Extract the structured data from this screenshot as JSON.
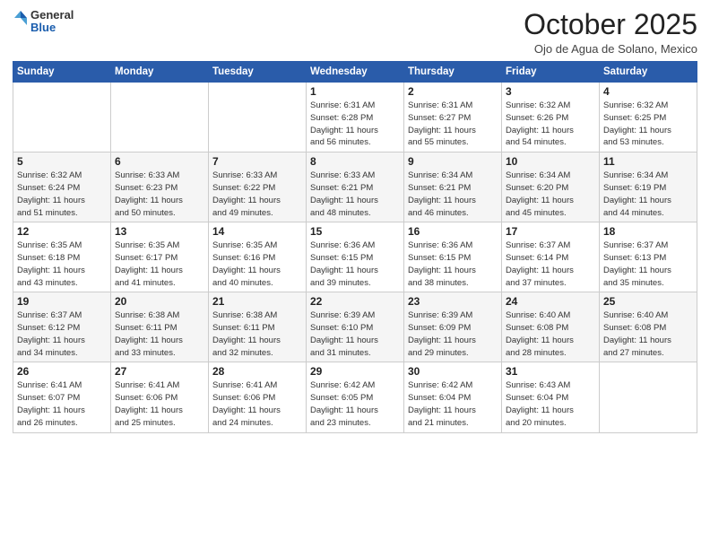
{
  "header": {
    "logo": {
      "general": "General",
      "blue": "Blue"
    },
    "title": "October 2025",
    "location": "Ojo de Agua de Solano, Mexico"
  },
  "weekdays": [
    "Sunday",
    "Monday",
    "Tuesday",
    "Wednesday",
    "Thursday",
    "Friday",
    "Saturday"
  ],
  "weeks": [
    [
      {
        "day": "",
        "info": ""
      },
      {
        "day": "",
        "info": ""
      },
      {
        "day": "",
        "info": ""
      },
      {
        "day": "1",
        "info": "Sunrise: 6:31 AM\nSunset: 6:28 PM\nDaylight: 11 hours\nand 56 minutes."
      },
      {
        "day": "2",
        "info": "Sunrise: 6:31 AM\nSunset: 6:27 PM\nDaylight: 11 hours\nand 55 minutes."
      },
      {
        "day": "3",
        "info": "Sunrise: 6:32 AM\nSunset: 6:26 PM\nDaylight: 11 hours\nand 54 minutes."
      },
      {
        "day": "4",
        "info": "Sunrise: 6:32 AM\nSunset: 6:25 PM\nDaylight: 11 hours\nand 53 minutes."
      }
    ],
    [
      {
        "day": "5",
        "info": "Sunrise: 6:32 AM\nSunset: 6:24 PM\nDaylight: 11 hours\nand 51 minutes."
      },
      {
        "day": "6",
        "info": "Sunrise: 6:33 AM\nSunset: 6:23 PM\nDaylight: 11 hours\nand 50 minutes."
      },
      {
        "day": "7",
        "info": "Sunrise: 6:33 AM\nSunset: 6:22 PM\nDaylight: 11 hours\nand 49 minutes."
      },
      {
        "day": "8",
        "info": "Sunrise: 6:33 AM\nSunset: 6:21 PM\nDaylight: 11 hours\nand 48 minutes."
      },
      {
        "day": "9",
        "info": "Sunrise: 6:34 AM\nSunset: 6:21 PM\nDaylight: 11 hours\nand 46 minutes."
      },
      {
        "day": "10",
        "info": "Sunrise: 6:34 AM\nSunset: 6:20 PM\nDaylight: 11 hours\nand 45 minutes."
      },
      {
        "day": "11",
        "info": "Sunrise: 6:34 AM\nSunset: 6:19 PM\nDaylight: 11 hours\nand 44 minutes."
      }
    ],
    [
      {
        "day": "12",
        "info": "Sunrise: 6:35 AM\nSunset: 6:18 PM\nDaylight: 11 hours\nand 43 minutes."
      },
      {
        "day": "13",
        "info": "Sunrise: 6:35 AM\nSunset: 6:17 PM\nDaylight: 11 hours\nand 41 minutes."
      },
      {
        "day": "14",
        "info": "Sunrise: 6:35 AM\nSunset: 6:16 PM\nDaylight: 11 hours\nand 40 minutes."
      },
      {
        "day": "15",
        "info": "Sunrise: 6:36 AM\nSunset: 6:15 PM\nDaylight: 11 hours\nand 39 minutes."
      },
      {
        "day": "16",
        "info": "Sunrise: 6:36 AM\nSunset: 6:15 PM\nDaylight: 11 hours\nand 38 minutes."
      },
      {
        "day": "17",
        "info": "Sunrise: 6:37 AM\nSunset: 6:14 PM\nDaylight: 11 hours\nand 37 minutes."
      },
      {
        "day": "18",
        "info": "Sunrise: 6:37 AM\nSunset: 6:13 PM\nDaylight: 11 hours\nand 35 minutes."
      }
    ],
    [
      {
        "day": "19",
        "info": "Sunrise: 6:37 AM\nSunset: 6:12 PM\nDaylight: 11 hours\nand 34 minutes."
      },
      {
        "day": "20",
        "info": "Sunrise: 6:38 AM\nSunset: 6:11 PM\nDaylight: 11 hours\nand 33 minutes."
      },
      {
        "day": "21",
        "info": "Sunrise: 6:38 AM\nSunset: 6:11 PM\nDaylight: 11 hours\nand 32 minutes."
      },
      {
        "day": "22",
        "info": "Sunrise: 6:39 AM\nSunset: 6:10 PM\nDaylight: 11 hours\nand 31 minutes."
      },
      {
        "day": "23",
        "info": "Sunrise: 6:39 AM\nSunset: 6:09 PM\nDaylight: 11 hours\nand 29 minutes."
      },
      {
        "day": "24",
        "info": "Sunrise: 6:40 AM\nSunset: 6:08 PM\nDaylight: 11 hours\nand 28 minutes."
      },
      {
        "day": "25",
        "info": "Sunrise: 6:40 AM\nSunset: 6:08 PM\nDaylight: 11 hours\nand 27 minutes."
      }
    ],
    [
      {
        "day": "26",
        "info": "Sunrise: 6:41 AM\nSunset: 6:07 PM\nDaylight: 11 hours\nand 26 minutes."
      },
      {
        "day": "27",
        "info": "Sunrise: 6:41 AM\nSunset: 6:06 PM\nDaylight: 11 hours\nand 25 minutes."
      },
      {
        "day": "28",
        "info": "Sunrise: 6:41 AM\nSunset: 6:06 PM\nDaylight: 11 hours\nand 24 minutes."
      },
      {
        "day": "29",
        "info": "Sunrise: 6:42 AM\nSunset: 6:05 PM\nDaylight: 11 hours\nand 23 minutes."
      },
      {
        "day": "30",
        "info": "Sunrise: 6:42 AM\nSunset: 6:04 PM\nDaylight: 11 hours\nand 21 minutes."
      },
      {
        "day": "31",
        "info": "Sunrise: 6:43 AM\nSunset: 6:04 PM\nDaylight: 11 hours\nand 20 minutes."
      },
      {
        "day": "",
        "info": ""
      }
    ]
  ]
}
